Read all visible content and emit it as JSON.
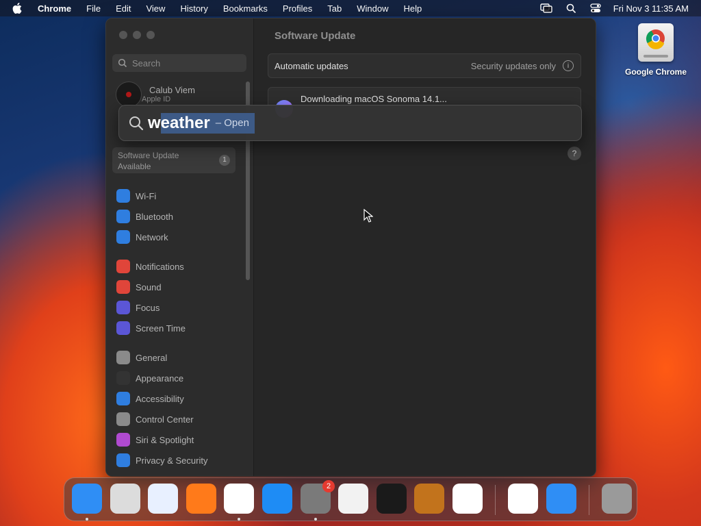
{
  "menubar": {
    "app_name": "Chrome",
    "items": [
      "File",
      "Edit",
      "View",
      "History",
      "Bookmarks",
      "Profiles",
      "Tab",
      "Window",
      "Help"
    ],
    "clock": "Fri Nov 3  11:35 AM"
  },
  "desktop": {
    "icon_label": "Google Chrome"
  },
  "sidebar": {
    "search_placeholder": "Search",
    "profile_name": "Calub Viem",
    "profile_sub": "Apple ID",
    "update_label": "Software Update Available",
    "update_badge": "1",
    "groups": [
      [
        {
          "label": "Wi-Fi",
          "icon": "wifi-icon",
          "color": "#2f7ee0"
        },
        {
          "label": "Bluetooth",
          "icon": "bluetooth-icon",
          "color": "#2f7ee0"
        },
        {
          "label": "Network",
          "icon": "globe-icon",
          "color": "#2f7ee0"
        }
      ],
      [
        {
          "label": "Notifications",
          "icon": "bell-icon",
          "color": "#e0453a"
        },
        {
          "label": "Sound",
          "icon": "speaker-icon",
          "color": "#e0453a"
        },
        {
          "label": "Focus",
          "icon": "moon-icon",
          "color": "#5b56d6"
        },
        {
          "label": "Screen Time",
          "icon": "hourglass-icon",
          "color": "#5b56d6"
        }
      ],
      [
        {
          "label": "General",
          "icon": "gear-icon",
          "color": "#8a8a8a"
        },
        {
          "label": "Appearance",
          "icon": "appearance-icon",
          "color": "#333333"
        },
        {
          "label": "Accessibility",
          "icon": "accessibility-icon",
          "color": "#2f7ee0"
        },
        {
          "label": "Control Center",
          "icon": "control-center-icon",
          "color": "#8a8a8a"
        },
        {
          "label": "Siri & Spotlight",
          "icon": "siri-icon",
          "color": "#b04ad0"
        },
        {
          "label": "Privacy & Security",
          "icon": "hand-icon",
          "color": "#2f7ee0"
        }
      ]
    ]
  },
  "main": {
    "title": "Software Update",
    "auto_updates_label": "Automatic updates",
    "auto_updates_value": "Security updates only",
    "info_glyph": "i",
    "download_text": "Downloading macOS Sonoma 14.1...",
    "help_glyph": "?"
  },
  "spotlight": {
    "query_typed": "w",
    "query_completion": "eather",
    "hint": "– Open"
  },
  "dock": {
    "apps": [
      {
        "name": "finder",
        "color": "#2f8ef5",
        "running": true
      },
      {
        "name": "launchpad",
        "color": "#dcdcdc",
        "running": false
      },
      {
        "name": "safari",
        "color": "#e8f0ff",
        "running": false
      },
      {
        "name": "firefox",
        "color": "#ff7a1a",
        "running": false
      },
      {
        "name": "chrome",
        "color": "#ffffff",
        "running": true
      },
      {
        "name": "app-store",
        "color": "#1e8cf5",
        "running": false
      },
      {
        "name": "system-settings",
        "color": "#7a7a7a",
        "running": true,
        "badge": "2"
      },
      {
        "name": "textedit",
        "color": "#f2f2f2",
        "running": false
      },
      {
        "name": "terminal",
        "color": "#1a1a1a",
        "running": false
      },
      {
        "name": "garageband",
        "color": "#c2731c",
        "running": false
      },
      {
        "name": "vscode",
        "color": "#ffffff",
        "running": false
      },
      {
        "name": "visual-studio",
        "color": "#ffffff",
        "running": false
      },
      {
        "name": "weather",
        "color": "#2f8ef5",
        "running": false
      },
      {
        "name": "trash",
        "color": "#9a9a9a",
        "running": false
      }
    ]
  }
}
